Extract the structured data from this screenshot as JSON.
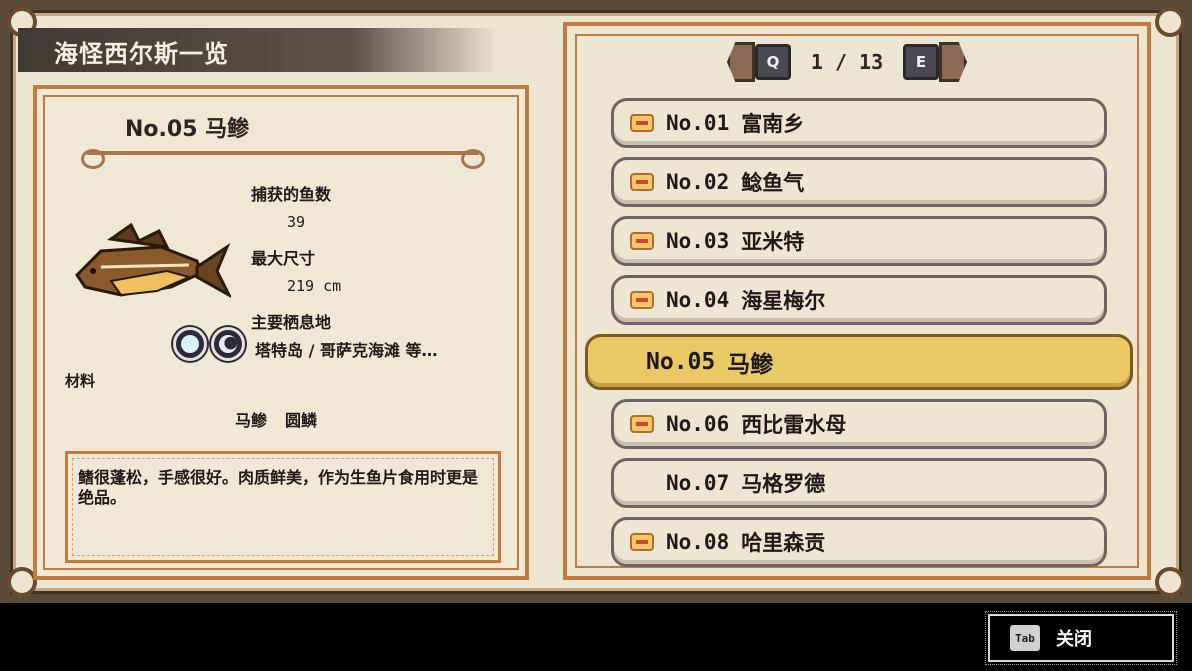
{
  "window": {
    "title": "海怪西尔斯一览"
  },
  "detail": {
    "fish_title": "No.05 马鲹",
    "caught_label": "捕获的鱼数",
    "caught_value": "39",
    "max_size_label": "最大尺寸",
    "max_size_value": "219 cm",
    "habitat_label": "主要栖息地",
    "habitat_text": "塔特岛 / 哥萨克海滩 等…",
    "material_label": "材料",
    "materials": [
      "马鲹",
      "圆鳞"
    ],
    "description": "鳍很蓬松，手感很好。肉质鲜美，作为生鱼片食用时更是绝品。"
  },
  "pager": {
    "prev_key": "Q",
    "next_key": "E",
    "page_text": "1 / 13"
  },
  "list": {
    "items": [
      {
        "num": "No.01",
        "name": "富南乡"
      },
      {
        "num": "No.02",
        "name": "鲶鱼气"
      },
      {
        "num": "No.03",
        "name": "亚米特"
      },
      {
        "num": "No.04",
        "name": "海星梅尔"
      },
      {
        "num": "No.05",
        "name": "马鲹"
      },
      {
        "num": "No.06",
        "name": "西比雷水母"
      },
      {
        "num": "No.07",
        "name": "马格罗德"
      },
      {
        "num": "No.08",
        "name": "哈里森贡"
      }
    ],
    "selected_index": 4
  },
  "footer": {
    "close_key": "Tab",
    "close_label": "关闭"
  },
  "colors": {
    "paper": "#ece5d2",
    "frame_orange": "#c27a3e",
    "selected_gold": "#eac866"
  }
}
